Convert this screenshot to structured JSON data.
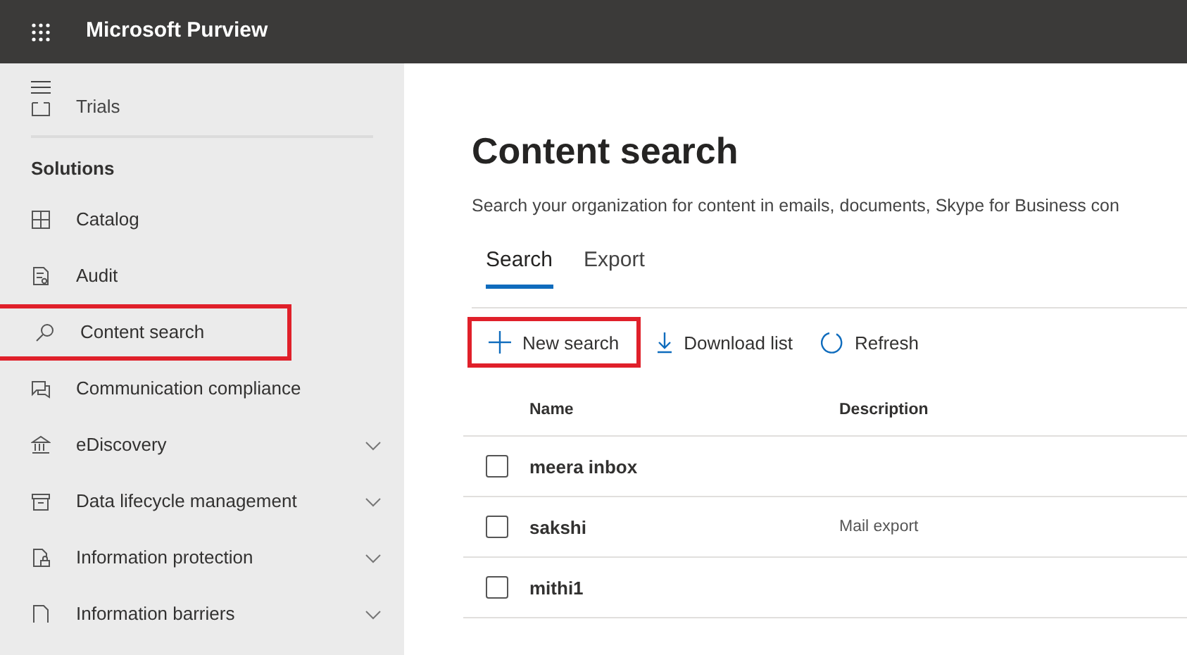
{
  "app_bar": {
    "title": "Microsoft Purview"
  },
  "sidebar": {
    "partial_item": {
      "label": "Trials"
    },
    "section_title": "Solutions",
    "items": [
      {
        "kind": "catalog",
        "label": "Catalog",
        "expandable": false,
        "highlighted": false
      },
      {
        "kind": "audit",
        "label": "Audit",
        "expandable": false,
        "highlighted": false
      },
      {
        "kind": "search",
        "label": "Content search",
        "expandable": false,
        "highlighted": true
      },
      {
        "kind": "chat",
        "label": "Communication compliance",
        "expandable": false,
        "highlighted": false
      },
      {
        "kind": "bank",
        "label": "eDiscovery",
        "expandable": true,
        "highlighted": false
      },
      {
        "kind": "archive",
        "label": "Data lifecycle management",
        "expandable": true,
        "highlighted": false
      },
      {
        "kind": "lockdoc",
        "label": "Information protection",
        "expandable": true,
        "highlighted": false
      },
      {
        "kind": "doc",
        "label": "Information barriers",
        "expandable": true,
        "highlighted": false
      }
    ]
  },
  "page": {
    "title": "Content search",
    "description": "Search your organization for content in emails, documents, Skype for Business con",
    "tabs": [
      {
        "label": "Search",
        "selected": true
      },
      {
        "label": "Export",
        "selected": false
      }
    ],
    "toolbar": [
      {
        "kind": "add",
        "label": "New search",
        "highlighted": true
      },
      {
        "kind": "download",
        "label": "Download list",
        "highlighted": false
      },
      {
        "kind": "refresh",
        "label": "Refresh",
        "highlighted": false
      }
    ],
    "table": {
      "columns": [
        "Name",
        "Description"
      ],
      "rows": [
        {
          "name": "meera inbox",
          "checked": false
        },
        {
          "name": "sakshi",
          "description": "Mail export",
          "checked": false
        },
        {
          "name": "mithi1",
          "checked": false
        }
      ]
    }
  }
}
